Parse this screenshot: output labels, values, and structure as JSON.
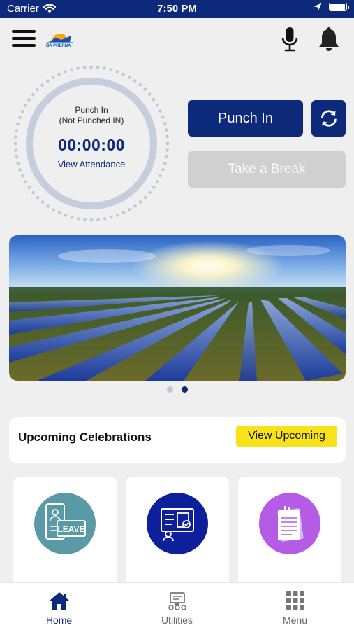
{
  "status_bar": {
    "carrier": "Carrier",
    "time": "7:50 PM",
    "battery_level": 0.95
  },
  "header": {
    "logo_text": "BA PRERNA",
    "icons": [
      "menu-icon",
      "microphone-icon",
      "bell-icon"
    ]
  },
  "punch": {
    "status": "Punch In",
    "sub_status": "(Not Punched IN)",
    "timer": "00:00:00",
    "view_attendance": "View Attendance",
    "punch_in_label": "Punch In",
    "take_break_label": "Take a Break"
  },
  "banner": {
    "image": "solar-farm-landscape",
    "slide_count": 2,
    "active_slide": 2
  },
  "celebrations": {
    "title": "Upcoming Celebrations",
    "button_label": "View Upcoming"
  },
  "tiles": [
    {
      "icon": "leave-icon",
      "badge_text": "LEAVE",
      "color": "#5a9aa6"
    },
    {
      "icon": "presentation-icon",
      "color": "#0d1f9a"
    },
    {
      "icon": "document-icon",
      "color": "#b45ce6"
    }
  ],
  "bottom_nav": {
    "items": [
      {
        "label": "Home",
        "icon": "home-icon",
        "active": true
      },
      {
        "label": "Utilities",
        "icon": "utilities-icon",
        "active": false
      },
      {
        "label": "Menu",
        "icon": "grid-icon",
        "active": false
      }
    ]
  },
  "colors": {
    "primary": "#0d2a7a",
    "accent_yellow": "#f8e21a",
    "disabled": "#d0d0d0",
    "background": "#efefef"
  }
}
